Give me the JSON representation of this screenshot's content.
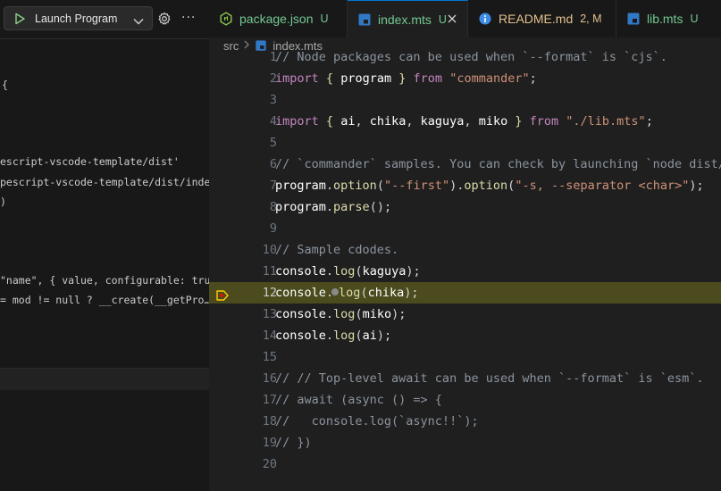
{
  "debug": {
    "config_label": "Launch Program",
    "console_lines": [
      {
        "text": "{",
        "color": "#cccccc"
      },
      {
        "text": "escript-vscode-template/dist'",
        "color": "#ce9178"
      },
      {
        "text": "pescript-vscode-template/dist/index…",
        "color": "#ce9178"
      },
      {
        "text": ")",
        "color": "#cccccc"
      },
      {
        "text": "\"name\", { value, configurable: tru…",
        "color": "#cccccc"
      },
      {
        "text": "= mod != null ? __create(__getPro…",
        "color": "#cccccc"
      }
    ]
  },
  "tabs": [
    {
      "name": "package.json",
      "badge": "U",
      "icon": "node-icon",
      "name_color": "#73c991",
      "badge_color": "#73c991",
      "active": false
    },
    {
      "name": "index.mts",
      "badge": "U",
      "icon": "typescript-icon",
      "name_color": "#73c991",
      "badge_color": "#73c991",
      "active": true
    },
    {
      "name": "README.md",
      "badge": "2, M",
      "icon": "info-icon",
      "name_color": "#e2c08d",
      "badge_color": "#e2c08d",
      "active": false
    },
    {
      "name": "lib.mts",
      "badge": "U",
      "icon": "typescript-icon",
      "name_color": "#73c991",
      "badge_color": "#73c991",
      "active": false
    }
  ],
  "breadcrumb": {
    "folder": "src",
    "file": "index.mts"
  },
  "editor": {
    "current_line": 12,
    "lines": [
      {
        "n": "1",
        "text": "// Node packages can be used when `--format` is `cjs`."
      },
      {
        "n": "2",
        "text": "import { program } from \"commander\";"
      },
      {
        "n": "3",
        "text": ""
      },
      {
        "n": "4",
        "text": "import { ai, chika, kaguya, miko } from \"./lib.mts\";"
      },
      {
        "n": "5",
        "text": ""
      },
      {
        "n": "6",
        "text": "// `commander` samples. You can check by launching `node dist/i"
      },
      {
        "n": "7",
        "text": "program.option(\"--first\").option(\"-s, --separator <char>\");"
      },
      {
        "n": "8",
        "text": "program.parse();"
      },
      {
        "n": "9",
        "text": ""
      },
      {
        "n": "10",
        "text": "// Sample cdodes."
      },
      {
        "n": "11",
        "text": "console.log(kaguya);"
      },
      {
        "n": "12",
        "text": "console.log(chika);"
      },
      {
        "n": "13",
        "text": "console.log(miko);"
      },
      {
        "n": "14",
        "text": "console.log(ai);"
      },
      {
        "n": "15",
        "text": ""
      },
      {
        "n": "16",
        "text": "// // Top-level await can be used when `--format` is `esm`."
      },
      {
        "n": "17",
        "text": "// await (async () => {"
      },
      {
        "n": "18",
        "text": "//   console.log(`async!!`);"
      },
      {
        "n": "19",
        "text": "// })"
      },
      {
        "n": "20",
        "text": ""
      }
    ]
  }
}
